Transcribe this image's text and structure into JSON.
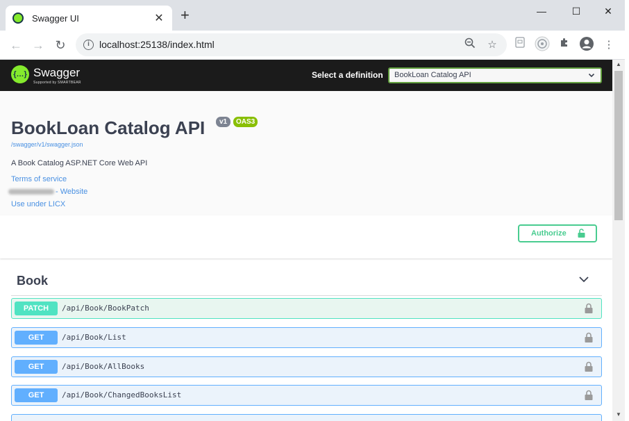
{
  "browser": {
    "tab_title": "Swagger UI",
    "tab_close": "✕",
    "new_tab": "+",
    "url": "localhost:25138/index.html",
    "window_controls": {
      "minimize": "—",
      "maximize": "☐",
      "close": "✕"
    }
  },
  "topbar": {
    "logo_text": "Swagger",
    "logo_subtitle": "Supported by SMARTBEAR",
    "definition_label": "Select a definition",
    "definition_selected": "BookLoan Catalog API"
  },
  "info": {
    "title": "BookLoan Catalog API",
    "version_badge": "v1",
    "oas_badge": "OAS3",
    "spec_url": "/swagger/v1/swagger.json",
    "description": "A Book Catalog ASP.NET Core Web API",
    "terms_link": "Terms of service",
    "contact_website": "- Website",
    "license_link": "Use under LICX"
  },
  "auth": {
    "authorize_label": "Authorize"
  },
  "section": {
    "tag": "Book",
    "operations": [
      {
        "method": "PATCH",
        "path": "/api/Book/BookPatch"
      },
      {
        "method": "GET",
        "path": "/api/Book/List"
      },
      {
        "method": "GET",
        "path": "/api/Book/AllBooks"
      },
      {
        "method": "GET",
        "path": "/api/Book/ChangedBooksList"
      }
    ]
  },
  "colors": {
    "swagger_green": "#85ea2d",
    "topbar_bg": "#1b1b1b",
    "patch": "#50e3c2",
    "get": "#61affe",
    "authorize": "#49cc90",
    "link": "#4990e2"
  }
}
